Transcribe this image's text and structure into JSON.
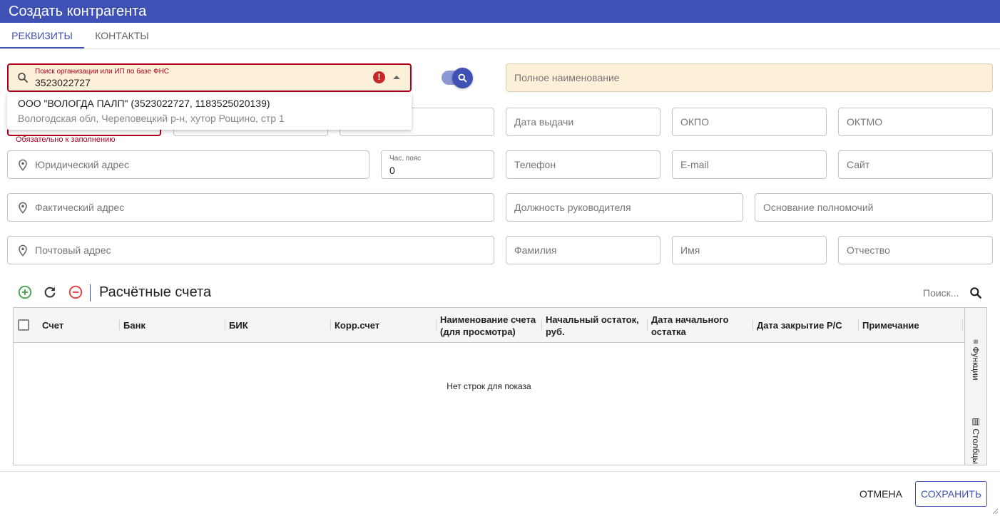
{
  "window": {
    "title": "Создать контрагента"
  },
  "tabs": [
    {
      "label": "РЕКВИЗИТЫ",
      "active": true
    },
    {
      "label": "КОНТАКТЫ",
      "active": false
    }
  ],
  "fns_search": {
    "label": "Поиск организации или ИП по базе ФНС",
    "value": "3523022727",
    "error_icon": "exclamation-circle-icon",
    "result_title": "ООО \"ВОЛОГДА ПАЛП\" (3523022727, 1183525020139)",
    "result_address": "Вологодская обл, Череповецкий р-н, хутор Рощино, стр 1",
    "required_message": "Обязательно к заполнению"
  },
  "fields": {
    "full_name": "Полное наименование",
    "issue_date": "Дата выдачи",
    "okpo": "ОКПО",
    "oktmo": "ОКТМО",
    "legal_address": "Юридический адрес",
    "timezone_label": "Час. пояс",
    "timezone_value": "0",
    "phone": "Телефон",
    "email": "E-mail",
    "site": "Сайт",
    "actual_address": "Фактический адрес",
    "manager_position": "Должность руководителя",
    "authority_basis": "Основание полномочий",
    "postal_address": "Почтовый адрес",
    "last_name": "Фамилия",
    "first_name": "Имя",
    "patronymic": "Отчество"
  },
  "accounts": {
    "title": "Расчётные счета",
    "search_placeholder": "Поиск...",
    "columns": [
      "Счет",
      "Банк",
      "БИК",
      "Корр.счет",
      "Наименование счета (для просмотра)",
      "Начальный остаток, руб.",
      "Дата начального остатка",
      "Дата закрытие Р/С",
      "Примечание"
    ],
    "empty_message": "Нет строк для показа",
    "side_functions": "Функции",
    "side_columns": "Столбцы"
  },
  "footer": {
    "cancel_label": "ОТМЕНА",
    "save_label": "СОХРАНИТЬ"
  },
  "colors": {
    "primary": "#3f51b5",
    "error": "#b00020",
    "warn_fill": "#fdf0d9",
    "add_green": "#43a047",
    "remove_red": "#e53935"
  }
}
